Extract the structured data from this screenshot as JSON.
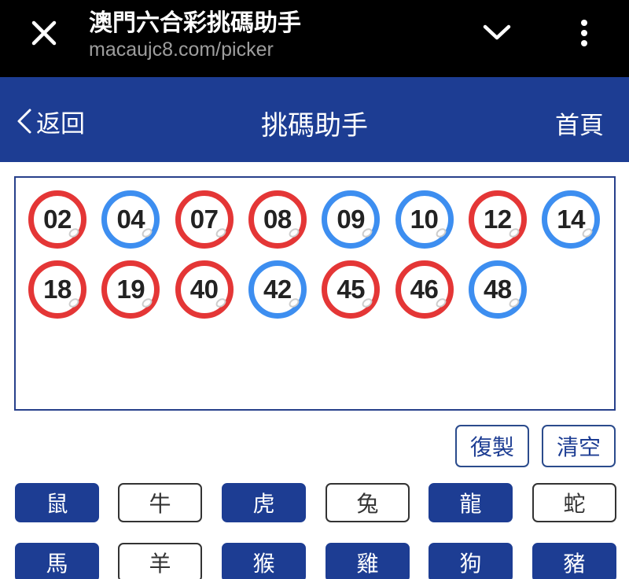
{
  "browser": {
    "title": "澳門六合彩挑碼助手",
    "url": "macaujc8.com/picker"
  },
  "header": {
    "back_label": "返回",
    "title": "挑碼助手",
    "home_label": "首頁",
    "color": "#1d3d93"
  },
  "selected_numbers": [
    {
      "num": "02",
      "color": "red"
    },
    {
      "num": "04",
      "color": "blue"
    },
    {
      "num": "07",
      "color": "red"
    },
    {
      "num": "08",
      "color": "red"
    },
    {
      "num": "09",
      "color": "blue"
    },
    {
      "num": "10",
      "color": "blue"
    },
    {
      "num": "12",
      "color": "red"
    },
    {
      "num": "14",
      "color": "blue"
    },
    {
      "num": "18",
      "color": "red"
    },
    {
      "num": "19",
      "color": "red"
    },
    {
      "num": "40",
      "color": "red"
    },
    {
      "num": "42",
      "color": "blue"
    },
    {
      "num": "45",
      "color": "red"
    },
    {
      "num": "46",
      "color": "red"
    },
    {
      "num": "48",
      "color": "blue"
    }
  ],
  "actions": {
    "copy_label": "復製",
    "clear_label": "清空"
  },
  "zodiac": [
    {
      "label": "鼠",
      "selected": true
    },
    {
      "label": "牛",
      "selected": false
    },
    {
      "label": "虎",
      "selected": true
    },
    {
      "label": "兔",
      "selected": false
    },
    {
      "label": "龍",
      "selected": true
    },
    {
      "label": "蛇",
      "selected": false
    },
    {
      "label": "馬",
      "selected": true
    },
    {
      "label": "羊",
      "selected": false
    },
    {
      "label": "猴",
      "selected": true
    },
    {
      "label": "雞",
      "selected": true
    },
    {
      "label": "狗",
      "selected": true
    },
    {
      "label": "豬",
      "selected": true
    }
  ],
  "colors": {
    "red_ball": "#e43636",
    "blue_ball": "#3d8ef0",
    "accent": "#1d3d93"
  }
}
